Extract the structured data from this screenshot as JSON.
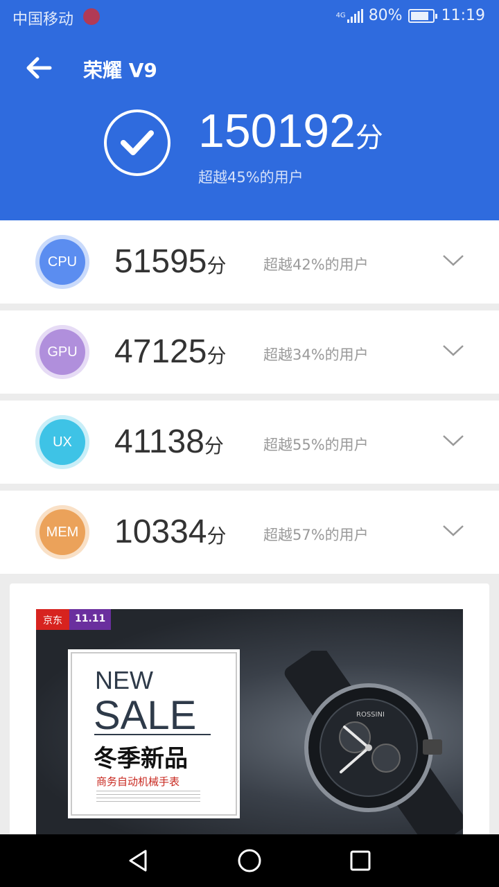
{
  "status_bar": {
    "carrier": "中国移动",
    "network": "4G",
    "battery_level": 0.8,
    "battery": "80%",
    "time": "11:19"
  },
  "header": {
    "title": "荣耀 V9",
    "total_score": "150192",
    "score_unit": "分",
    "percentile_text": "超越45%的用户",
    "background_color": "#2f6bde"
  },
  "scores": [
    {
      "label": "CPU",
      "score": "51595",
      "unit": "分",
      "percentile_text": "超越42%的用户",
      "color": "#5b8df0",
      "ring_color": "#c9dafb"
    },
    {
      "label": "GPU",
      "score": "47125",
      "unit": "分",
      "percentile_text": "超越34%的用户",
      "color": "#b08fdc",
      "ring_color": "#e6dbf5"
    },
    {
      "label": "UX",
      "score": "41138",
      "unit": "分",
      "percentile_text": "超越55%的用户",
      "color": "#3ec3e6",
      "ring_color": "#c8eef8"
    },
    {
      "label": "MEM",
      "score": "10334",
      "unit": "分",
      "percentile_text": "超越57%的用户",
      "color": "#eba25a",
      "ring_color": "#f9e0c6"
    }
  ],
  "ad": {
    "badge_store": "京东",
    "badge_event": "11.11",
    "headline_1": "NEW",
    "headline_2": "SALE",
    "headline_cn": "冬季新品",
    "subline": "商务自动机械手表",
    "watch_brand": "ROSSINI"
  },
  "icons": {
    "back": "arrow-left-icon",
    "check": "check-circle-icon",
    "expand": "chevron-down-icon",
    "nav_back": "triangle-back-icon",
    "nav_home": "circle-home-icon",
    "nav_recent": "square-recent-icon"
  }
}
